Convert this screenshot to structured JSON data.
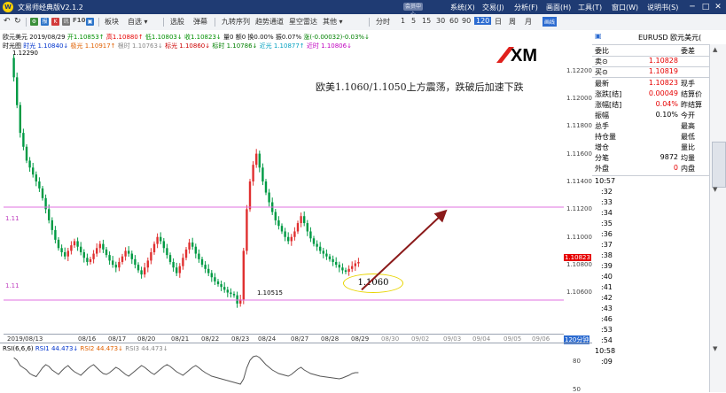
{
  "window": {
    "logo": "W",
    "title": "文易师经典版V2.1.2",
    "menus": [
      "系统(X)",
      "交易(J)",
      "分析(F)",
      "画面(H)",
      "工具(T)",
      "窗口(W)",
      "说明书(S)"
    ],
    "tag": "会员中心"
  },
  "toolbar": {
    "nav_icons": [
      "back-icon",
      "refresh-icon"
    ],
    "tool_icons": [
      {
        "name": "settings-icon",
        "glyph": "⚙"
      },
      {
        "name": "quote-icon",
        "glyph": "报"
      },
      {
        "name": "chart-k-icon",
        "glyph": "K"
      },
      {
        "name": "news-icon",
        "glyph": "讯"
      },
      {
        "name": "f10-icon",
        "glyph": "F10"
      },
      {
        "name": "layout-icon",
        "glyph": "▣"
      }
    ],
    "group1": [
      "板块",
      "自选 ▾"
    ],
    "group2": [
      "选股",
      "弹幕"
    ],
    "group3": [
      "九转序列",
      "趋势通道",
      "星空雷达",
      "其他 ▾"
    ],
    "periods": [
      "分时",
      "1",
      "5",
      "15",
      "30",
      "60",
      "90",
      "120",
      "日",
      "周",
      "月"
    ],
    "selected_period": "120",
    "badge": "画线"
  },
  "quote_header": {
    "name": "欧元美元",
    "date": "2019/08/29",
    "open": "开1.10853↑",
    "high": "高1.10880↑",
    "low": "低1.10803↓",
    "close": "收1.10823↓",
    "volume": "量0",
    "amount": "额0",
    "turnover": "换0.00%",
    "amplitude": "振0.07%",
    "change": "涨(-0.00032)-0.03%↓"
  },
  "time_light": {
    "label": "时光图",
    "items": [
      {
        "text": "时光 1.10840↓",
        "color": "#0033cc"
      },
      {
        "text": "极光 1.10917↑",
        "color": "#e06000"
      },
      {
        "text": "根时 1.10763↓",
        "color": "#888888"
      },
      {
        "text": "标光 1.10860↓",
        "color": "#cc0000"
      },
      {
        "text": "标时 1.10786↓",
        "color": "#008000"
      },
      {
        "text": "近光 1.10877↑",
        "color": "#00a0c0"
      },
      {
        "text": "近时 1.10806↓",
        "color": "#c000c0"
      }
    ]
  },
  "annotation": {
    "brand": "XM",
    "headline": "欧美1.1060/1.1050上方震荡，跌破后加速下跌",
    "circle_text": "1.1060",
    "low_label": "1.10515",
    "high_label": "1.12290",
    "line_label_upper": "1.11",
    "line_label_lower": "1.11",
    "period_label": "120分钟",
    "last_price_label": "1.10823"
  },
  "rsi": {
    "title": "RSI(6,6,6)",
    "values": [
      {
        "text": "RSI1 44.473↓",
        "color": "#0033cc"
      },
      {
        "text": "RSI2 44.473↓",
        "color": "#e06000"
      },
      {
        "text": "RSI3 44.473↓",
        "color": "#888888"
      }
    ],
    "levels": [
      "80",
      "50"
    ]
  },
  "chart_data": {
    "type": "candlestick",
    "title": "",
    "symbol": "EURUSD",
    "interval": "120分钟",
    "ylim": [
      1.1045,
      1.1235
    ],
    "y_ticks": [
      "1.12200",
      "1.12000",
      "1.11800",
      "1.11600",
      "1.11400",
      "1.11200",
      "1.11000",
      "1.10800",
      "1.10600"
    ],
    "x_ticks": [
      "2019/08/13",
      "08/16",
      "08/17",
      "08/20",
      "08/21",
      "08/22",
      "08/23",
      "08/24",
      "08/27",
      "08/28",
      "08/29",
      "08/30",
      "09/02",
      "09/03",
      "09/04",
      "09/05",
      "09/06"
    ],
    "horizontal_lines": [
      1.1131,
      1.1062
    ],
    "path": [
      1.1229,
      1.1215,
      1.1195,
      1.1175,
      1.1165,
      1.1155,
      1.115,
      1.1145,
      1.114,
      1.1135,
      1.1128,
      1.112,
      1.1112,
      1.1105,
      1.1098,
      1.1092,
      1.1089,
      1.1086,
      1.109,
      1.1094,
      1.1097,
      1.1093,
      1.1089,
      1.1085,
      1.1082,
      1.1084,
      1.1088,
      1.1092,
      1.1095,
      1.1091,
      1.1087,
      1.1083,
      1.108,
      1.1078,
      1.1082,
      1.1086,
      1.109,
      1.1088,
      1.1084,
      1.108,
      1.1076,
      1.1073,
      1.1078,
      1.1083,
      1.1089,
      1.1095,
      1.11,
      1.1097,
      1.1092,
      1.1087,
      1.1082,
      1.1078,
      1.1074,
      1.1079,
      1.1085,
      1.1091,
      1.1096,
      1.1093,
      1.1088,
      1.1084,
      1.108,
      1.1077,
      1.1074,
      1.1071,
      1.1068,
      1.1066,
      1.1064,
      1.1062,
      1.106,
      1.1059,
      1.1058,
      1.1052,
      1.1055,
      1.109,
      1.112,
      1.114,
      1.1152,
      1.116,
      1.115,
      1.114,
      1.1132,
      1.1125,
      1.1118,
      1.1112,
      1.1108,
      1.1104,
      1.11,
      1.1097,
      1.11,
      1.1104,
      1.111,
      1.1115,
      1.111,
      1.1104,
      1.1099,
      1.1095,
      1.1093,
      1.109,
      1.1088,
      1.1086,
      1.1084,
      1.1082,
      1.108,
      1.1078,
      1.1076,
      1.1075,
      1.1077,
      1.1079,
      1.1081,
      1.1082
    ],
    "forecast_arrow": {
      "from": [
        110,
        1.1062
      ],
      "to": [
        136,
        1.1118
      ]
    },
    "rsi_series": [
      78,
      72,
      60,
      55,
      50,
      42,
      38,
      35,
      45,
      55,
      62,
      58,
      50,
      45,
      40,
      48,
      55,
      60,
      52,
      46,
      42,
      38,
      45,
      52,
      58,
      62,
      55,
      48,
      42,
      40,
      44,
      50,
      56,
      52,
      46,
      40,
      36,
      42,
      48,
      54,
      60,
      56,
      50,
      44,
      40,
      46,
      52,
      58,
      62,
      58,
      52,
      46,
      42,
      38,
      44,
      50,
      56,
      60,
      55,
      49,
      44,
      40,
      36,
      34,
      32,
      30,
      28,
      26,
      24,
      22,
      20,
      18,
      30,
      55,
      72,
      80,
      82,
      78,
      70,
      62,
      56,
      50,
      46,
      42,
      40,
      38,
      36,
      40,
      46,
      52,
      56,
      50,
      46,
      42,
      40,
      38,
      36,
      35,
      34,
      33,
      32,
      31,
      30,
      32,
      35,
      38,
      42,
      44,
      44
    ]
  },
  "quote_panel": {
    "header": "EURUSD 欧元美元(",
    "row_weibi": {
      "label": "委比",
      "value": "",
      "label2": "委差",
      "value2": ""
    },
    "sell": {
      "label": "卖⊙",
      "value": "1.10828"
    },
    "buy": {
      "label": "买⊙",
      "value": "1.10819"
    },
    "rows": [
      {
        "label": "最新",
        "value": "1.10823",
        "label2": "现手",
        "value2": "",
        "color": "#e60000"
      },
      {
        "label": "涨跌[结]",
        "value": "0.00049",
        "label2": "结算价",
        "value2": "",
        "color": "#e60000"
      },
      {
        "label": "涨幅[结]",
        "value": "0.04%",
        "label2": "昨结算",
        "value2": "",
        "color": "#e60000"
      },
      {
        "label": "振幅",
        "value": "0.10%",
        "label2": "今开",
        "value2": "",
        "color": "#000000"
      },
      {
        "label": "总手",
        "value": "",
        "label2": "最高",
        "value2": "",
        "color": "#000000"
      },
      {
        "label": "持仓量",
        "value": "",
        "label2": "最低",
        "value2": "",
        "color": "#000000"
      },
      {
        "label": "增仓",
        "value": "",
        "label2": "量比",
        "value2": "",
        "color": "#000000"
      },
      {
        "label": "分笔",
        "value": "9872",
        "label2": "均量",
        "value2": "",
        "color": "#000000"
      },
      {
        "label": "外盘",
        "value": "0",
        "label2": "内盘",
        "value2": "",
        "color": "#e60000"
      }
    ],
    "ticks_header": "10:57",
    "ticks": [
      ":32",
      ":33",
      ":34",
      ":35",
      ":36",
      ":37",
      ":38",
      ":39",
      ":40",
      ":41",
      ":42",
      ":43",
      ":46",
      ":53",
      ":54"
    ],
    "ticks_header2": "10:58",
    "ticks2": [
      ":09"
    ]
  }
}
